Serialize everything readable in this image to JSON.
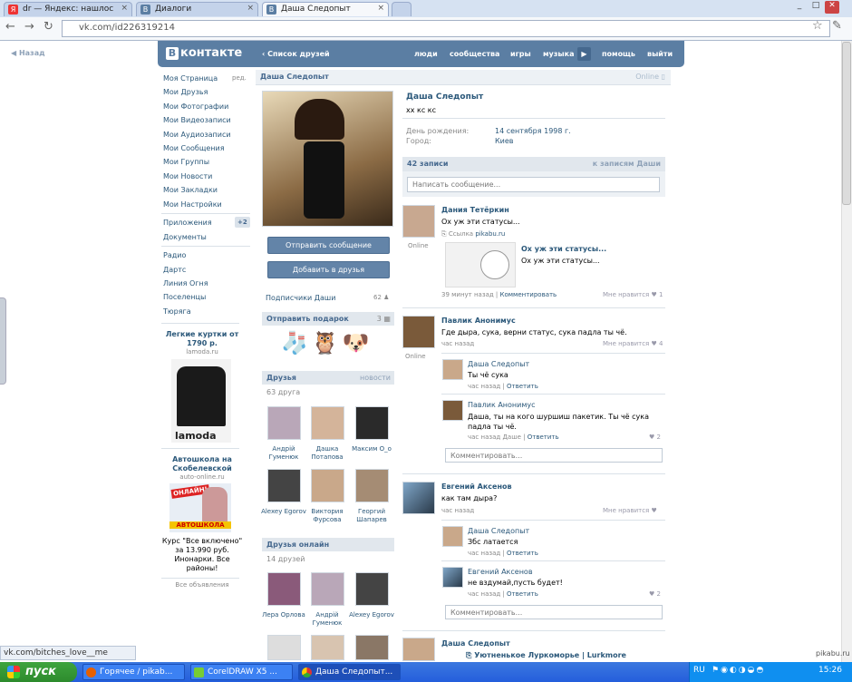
{
  "browser": {
    "tabs": [
      {
        "label": "dr — Яндекс: нашлос",
        "icon": "yandex-icon"
      },
      {
        "label": "Диалоги",
        "icon": "vk-icon"
      },
      {
        "label": "Даша Следопыт",
        "icon": "vk-icon"
      }
    ],
    "url": "vk.com/id226319214",
    "status_url": "vk.com/bitches_love__me"
  },
  "back_label": "Назад",
  "header": {
    "logo": "контакте",
    "logo_letter": "B",
    "friends_list": "Список друзей",
    "links": [
      "люди",
      "сообщества",
      "игры",
      "музыка",
      "помощь",
      "выйти"
    ]
  },
  "left_nav": {
    "items": [
      "Моя Страница",
      "Мои Друзья",
      "Мои Фотографии",
      "Мои Видеозаписи",
      "Мои Аудиозаписи",
      "Мои Сообщения",
      "Мои Группы",
      "Мои Новости",
      "Мои Закладки",
      "Мои Настройки"
    ],
    "edit": "ред.",
    "apps": "Приложения",
    "apps_badge": "+2",
    "docs": "Документы",
    "apps_list": [
      "Радио",
      "Дартс",
      "Линия Огня",
      "Поселенцы",
      "Тюряга"
    ]
  },
  "ads": {
    "ad1_title": "Легкие куртки от 1790 р.",
    "ad1_domain": "lamoda.ru",
    "ad1_brand": "lamoda",
    "ad2_title": "Автошкола на Скобелевской",
    "ad2_domain": "auto-online.ru",
    "ad2_badge1": "ОНЛАЙН!",
    "ad2_badge2": "АВТОШКОЛА",
    "ad2_text": "Курс \"Все включено\" за 13.990 руб. Инонарки. Все районы!",
    "all_ads": "Все объявления"
  },
  "profile": {
    "name_bar": "Даша Следопыт",
    "online": "Online",
    "name": "Даша Следопыт",
    "status": "хх кс кс",
    "birthday_label": "День рождения:",
    "birthday": "14 сентября 1998 г.",
    "city_label": "Город:",
    "city": "Киев",
    "send_message": "Отправить сообщение",
    "add_friend": "Добавить в друзья",
    "subscribers_label": "Подписчики Даши",
    "subscribers_count": "62",
    "gift_label": "Отправить подарок",
    "gift_count": "3",
    "friends_label": "Друзья",
    "friends_news": "новости",
    "friends_count": "63 друга",
    "friends": [
      {
        "name": "Андрій Гуменюк"
      },
      {
        "name": "Дашка Потапова"
      },
      {
        "name": "Максим O_o"
      },
      {
        "name": "Alexey Egorov"
      },
      {
        "name": "Виктория Фурсова"
      },
      {
        "name": "Георгий Шапарев"
      }
    ],
    "online_label": "Друзья онлайн",
    "online_count": "14 друзей",
    "online_friends": [
      {
        "name": "Лера Орлова"
      },
      {
        "name": "Андрій Гуменюк"
      },
      {
        "name": "Alexey Egorov"
      }
    ]
  },
  "wall": {
    "count": "42 записи",
    "to_posts": "к записям Даши",
    "placeholder": "Написать сообщение...",
    "posts": [
      {
        "author": "Дания Тетёркин",
        "text": "Ох уж эти статусы...",
        "link_prefix": "Ссылка",
        "link_domain": "pikabu.ru",
        "preview_title": "Ох уж эти статусы...",
        "preview_text": "Ох уж эти статусы...",
        "online": "Online",
        "time": "39 минут назад",
        "comment": "Комментировать",
        "likes_label": "Мне нравится",
        "likes": "1"
      },
      {
        "author": "Павлик Анонимус",
        "text": "Где дыра, сука, верни статус, сука падла ты чё.",
        "online": "Online",
        "time": "час назад",
        "likes_label": "Мне нравится",
        "likes": "4",
        "replies": [
          {
            "author": "Даша Следопыт",
            "text": "Ты чё сука",
            "time": "час назад",
            "reply": "Ответить"
          },
          {
            "author": "Павлик Анонимус",
            "text": "Даша, ты на кого шуршиш пакетик. Ты чё сука падла ты чё.",
            "time": "час назад Даше",
            "reply": "Ответить",
            "likes": "2"
          }
        ],
        "comment_placeholder": "Комментировать..."
      },
      {
        "author": "Евгений Аксенов",
        "text": "как там дыра?",
        "time": "час назад",
        "likes_label": "Мне нравится",
        "replies": [
          {
            "author": "Даша Следопыт",
            "text": "Збс латается",
            "time": "час назад",
            "reply": "Ответить"
          },
          {
            "author": "Евгений Аксенов",
            "text": "не вздумай,пусть будет!",
            "time": "час назад",
            "reply": "Ответить",
            "likes": "2"
          }
        ],
        "comment_placeholder": "Комментировать..."
      },
      {
        "author": "Даша Следопыт",
        "link_text": "Уютненькое Луркоморье | Lurkmore"
      }
    ]
  },
  "taskbar": {
    "start": "пуск",
    "tasks": [
      "Горячее / pikab...",
      "CorelDRAW X5 ...",
      "Даша Следопыт..."
    ],
    "lang": "RU",
    "clock": "15:26"
  },
  "watermark": "pikabu.ru"
}
